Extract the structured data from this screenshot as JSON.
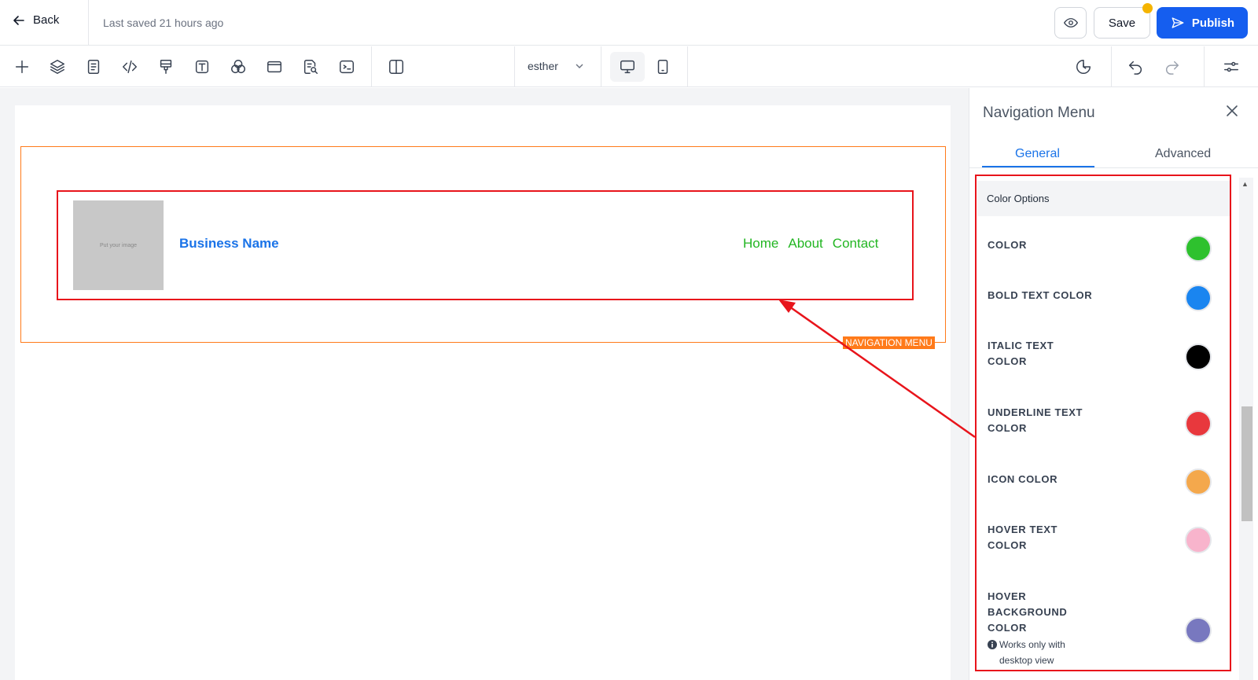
{
  "header": {
    "back_label": "Back",
    "saved_status": "Last saved 21 hours ago",
    "save_label": "Save",
    "publish_label": "Publish"
  },
  "toolbar": {
    "page_name": "esther",
    "icons": [
      "plus-icon",
      "layers-icon",
      "page-icon",
      "code-icon",
      "paint-icon",
      "text-icon",
      "colors-icon",
      "window-icon",
      "seo-icon",
      "terminal-icon",
      "columns-icon"
    ]
  },
  "canvas": {
    "image_placeholder": "Put your image",
    "business_name": "Business Name",
    "nav_links": [
      "Home",
      "About",
      "Contact"
    ],
    "section_tag": "NAVIGATION MENU"
  },
  "panel": {
    "title": "Navigation Menu",
    "tabs": [
      "General",
      "Advanced"
    ],
    "active_tab": "General",
    "section_header": "Color Options",
    "options": [
      {
        "label": "COLOR",
        "color": "#2ec12e"
      },
      {
        "label": "BOLD TEXT COLOR",
        "color": "#1a85f0"
      },
      {
        "label": "ITALIC TEXT COLOR",
        "color": "#000000"
      },
      {
        "label": "UNDERLINE TEXT COLOR",
        "color": "#e8383d"
      },
      {
        "label": "ICON COLOR",
        "color": "#f4a84c"
      },
      {
        "label": "HOVER TEXT COLOR",
        "color": "#f8b4cc"
      },
      {
        "label": "HOVER BACKGROUND COLOR",
        "color": "#7878bf",
        "note": "Works only with desktop view"
      }
    ]
  },
  "colors": {
    "accent": "#155eef",
    "highlight": "#e8141b",
    "selection": "#ff7a1a"
  }
}
